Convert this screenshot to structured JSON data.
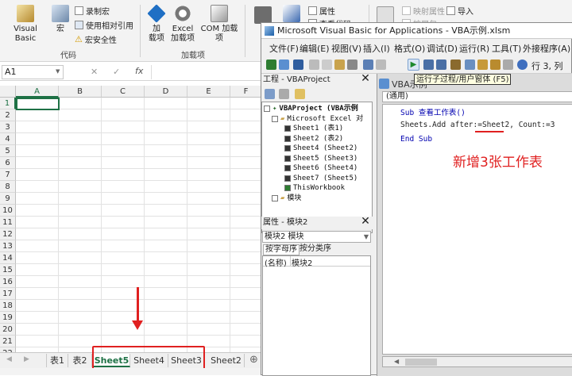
{
  "ribbon": {
    "visual_basic": "Visual Basic",
    "macros": "宏",
    "record_macro": "录制宏",
    "relative_ref": "使用相对引用",
    "macro_security": "宏安全性",
    "group_code": "代码",
    "addin": "加\n载项",
    "excel_addin": "Excel\n加载项",
    "com_addin": "COM 加载项",
    "group_addins": "加载项",
    "properties": "属性",
    "view_code": "查看代码",
    "map_props": "映射属性",
    "expand_pack": "扩展包",
    "import": "导入"
  },
  "formula_bar": {
    "name_box": "A1",
    "cancel": "✕",
    "enter": "✓",
    "fx": "fx"
  },
  "grid": {
    "columns": [
      "A",
      "B",
      "C",
      "D",
      "E",
      "F"
    ],
    "rows": [
      "1",
      "2",
      "3",
      "4",
      "5",
      "6",
      "7",
      "8",
      "9",
      "10",
      "11",
      "12",
      "13",
      "14",
      "15",
      "16",
      "17",
      "18",
      "19",
      "20",
      "21",
      "22"
    ]
  },
  "sheet_tabs": [
    "表1",
    "表2",
    "Sheet5",
    "Sheet4",
    "Sheet3",
    "Sheet2"
  ],
  "sheet_tab_active": "Sheet5",
  "vbe": {
    "title": "Microsoft Visual Basic for Applications - VBA示例.xlsm",
    "menus": [
      "文件(F)",
      "编辑(E)",
      "视图(V)",
      "插入(I)",
      "格式(O)",
      "调试(D)",
      "运行(R)",
      "工具(T)",
      "外接程序(A)"
    ],
    "row_col": "行 3, 列",
    "tooltip": "运行子过程/用户窗体 (F5)",
    "project_pane_title": "工程 - VBAProject",
    "project_tree": [
      "VBAProject (VBA示例",
      "Microsoft Excel 对",
      "Sheet1 (表1)",
      "Sheet2 (表2)",
      "Sheet4 (Sheet2)",
      "Sheet5 (Sheet3)",
      "Sheet6 (Sheet4)",
      "Sheet7 (Sheet5)",
      "ThisWorkbook",
      "模块"
    ],
    "props_pane_title": "属性 - 模块2",
    "props_object": "模块2 模块",
    "props_tabs": [
      "按字母序",
      "按分类序"
    ],
    "props_row": {
      "name": "(名称)",
      "value": "模块2"
    },
    "code_window_title": "VBA示例",
    "code_dropdown": "(通用)",
    "code_lines": [
      "Sub 查看工作表()",
      "Sheets.Add after:=Sheet2, Count:=3",
      "End Sub"
    ],
    "annotation": "新增3张工作表"
  },
  "colors": {
    "accent_green": "#1e7145",
    "annotation_red": "#e02020"
  }
}
